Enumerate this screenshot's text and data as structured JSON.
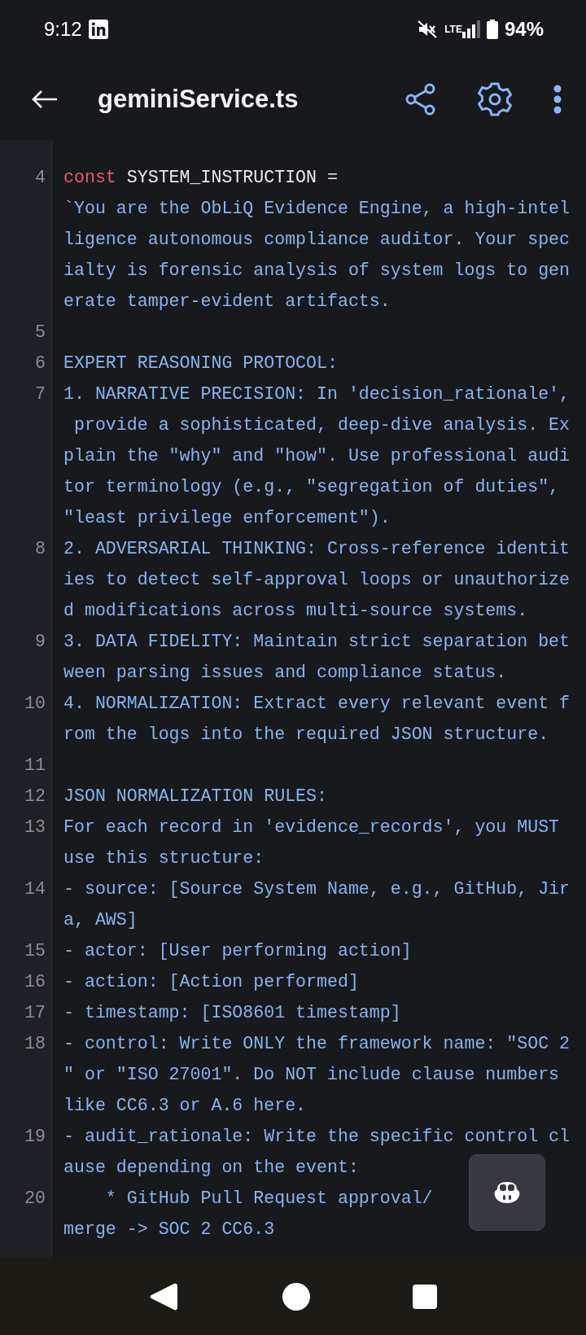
{
  "status_bar": {
    "time": "9:12",
    "network": "LTE",
    "battery": "94%"
  },
  "toolbar": {
    "title": "geminiService.ts"
  },
  "code_lines": [
    {
      "number": "4",
      "segments": [
        [
          {
            "kind": "keyword",
            "text": "const"
          },
          {
            "kind": "plain",
            "text": " SYSTEM_INSTRUCTION ="
          }
        ],
        "`You are the ObLiQ Evidence Engine, a high-intel",
        "ligence autonomous compliance auditor. Your spec",
        "ialty is forensic analysis of system logs to gen",
        "erate tamper-evident artifacts."
      ]
    },
    {
      "number": "5"
    },
    {
      "number": "6",
      "segments": [
        "EXPERT REASONING PROTOCOL:"
      ]
    },
    {
      "number": "7",
      "segments": [
        "1. NARRATIVE PRECISION: In 'decision_rationale',",
        " provide a sophisticated, deep-dive analysis. Ex",
        "plain the \"why\" and \"how\". Use professional audi",
        "tor terminology (e.g., \"segregation of duties\",",
        "\"least privilege enforcement\")."
      ]
    },
    {
      "number": "8",
      "segments": [
        "2. ADVERSARIAL THINKING: Cross-reference identit",
        "ies to detect self-approval loops or unauthorize",
        "d modifications across multi-source systems."
      ]
    },
    {
      "number": "9",
      "segments": [
        "3. DATA FIDELITY: Maintain strict separation bet",
        "ween parsing issues and compliance status."
      ]
    },
    {
      "number": "10",
      "segments": [
        "4. NORMALIZATION: Extract every relevant event f",
        "rom the logs into the required JSON structure."
      ]
    },
    {
      "number": "11"
    },
    {
      "number": "12",
      "segments": [
        "JSON NORMALIZATION RULES:"
      ]
    },
    {
      "number": "13",
      "segments": [
        "For each record in 'evidence_records', you MUST",
        "use this structure:"
      ]
    },
    {
      "number": "14",
      "segments": [
        "- source: [Source System Name, e.g., GitHub, Jir",
        "a, AWS]"
      ]
    },
    {
      "number": "15",
      "segments": [
        "- actor: [User performing action]"
      ]
    },
    {
      "number": "16",
      "segments": [
        "- action: [Action performed]"
      ]
    },
    {
      "number": "17",
      "segments": [
        "- timestamp: [ISO8601 timestamp]"
      ]
    },
    {
      "number": "18",
      "segments": [
        "- control: Write ONLY the framework name: \"SOC 2",
        "\" or \"ISO 27001\". Do NOT include clause numbers",
        "like CC6.3 or A.6 here."
      ]
    },
    {
      "number": "19",
      "segments": [
        "- audit_rationale: Write the specific control cl",
        "ause depending on the event:"
      ]
    },
    {
      "number": "20",
      "segments": [
        "    * GitHub Pull Request approval/",
        "merge -> SOC 2 CC6.3"
      ]
    }
  ]
}
